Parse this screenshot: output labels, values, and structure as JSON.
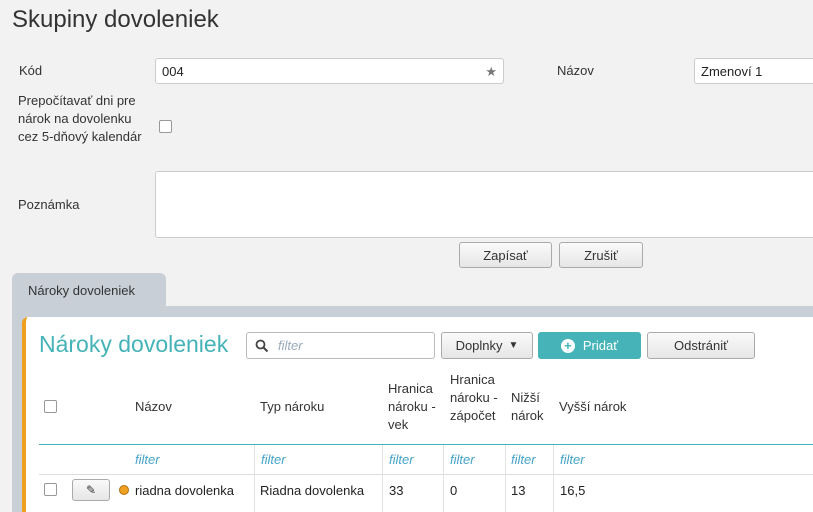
{
  "page": {
    "title": "Skupiny dovoleniek"
  },
  "form": {
    "kod_label": "Kód",
    "kod_value": "004",
    "nazov_label": "Názov",
    "nazov_value": "Zmenoví 1",
    "recalc_label": "Prepočítavať dni pre nárok na dovolenku cez 5-dňový kalendár",
    "recalc_checked": false,
    "poznamka_label": "Poznámka",
    "poznamka_value": "",
    "save_label": "Zapísať",
    "cancel_label": "Zrušiť"
  },
  "tabs": [
    {
      "label": "Nároky dovoleniek"
    }
  ],
  "panel": {
    "title": "Nároky dovoleniek",
    "filter_placeholder": "filter",
    "doplnky_label": "Doplnky",
    "add_label": "Pridať",
    "remove_label": "Odstrániť",
    "accent_color": "#45b3b8",
    "stripe_color": "#f0a020"
  },
  "table": {
    "columns": [
      "Názov",
      "Typ nároku",
      "Hranica nároku - vek",
      "Hranica nároku - zápočet",
      "Nižší nárok",
      "Vyšší nárok"
    ],
    "filter_text": "filter",
    "rows": [
      {
        "nazov": "riadna dovolenka",
        "typ": "Riadna dovolenka",
        "vek": "33",
        "zapocet": "0",
        "nizsi": "13",
        "vyssi": "16,5"
      }
    ]
  }
}
